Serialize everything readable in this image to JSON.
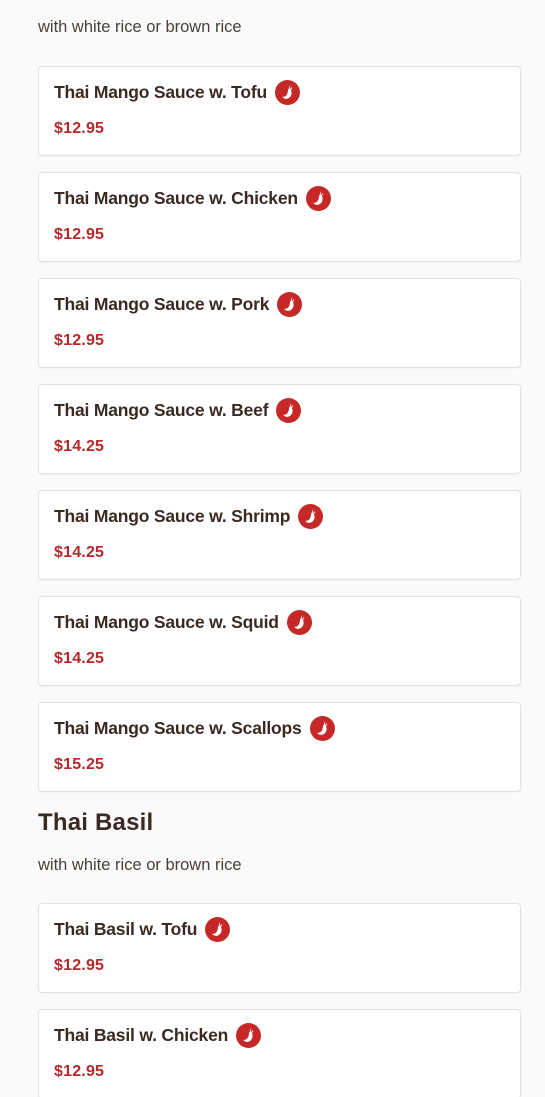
{
  "colors": {
    "price": "#b5292a",
    "spicy_icon": "#c62828",
    "text": "#3a2a22"
  },
  "sections": [
    {
      "description": "with white rice or brown rice",
      "items": [
        {
          "name": "Thai Mango Sauce w. Tofu",
          "price": "$12.95",
          "icon": "spicy-pepper-icon"
        },
        {
          "name": "Thai Mango Sauce w. Chicken",
          "price": "$12.95",
          "icon": "spicy-pepper-icon"
        },
        {
          "name": "Thai Mango Sauce w. Pork",
          "price": "$12.95",
          "icon": "spicy-pepper-icon"
        },
        {
          "name": "Thai Mango Sauce w. Beef",
          "price": "$14.25",
          "icon": "spicy-pepper-icon"
        },
        {
          "name": "Thai Mango Sauce w. Shrimp",
          "price": "$14.25",
          "icon": "spicy-pepper-icon"
        },
        {
          "name": "Thai Mango Sauce w. Squid",
          "price": "$14.25",
          "icon": "spicy-pepper-icon"
        },
        {
          "name": "Thai Mango Sauce w. Scallops",
          "price": "$15.25",
          "icon": "spicy-pepper-icon"
        }
      ]
    },
    {
      "title": "Thai Basil",
      "description": "with white rice or brown rice",
      "items": [
        {
          "name": "Thai Basil w. Tofu",
          "price": "$12.95",
          "icon": "spicy-pepper-icon"
        },
        {
          "name": "Thai Basil w. Chicken",
          "price": "$12.95",
          "icon": "spicy-pepper-icon"
        }
      ]
    }
  ]
}
